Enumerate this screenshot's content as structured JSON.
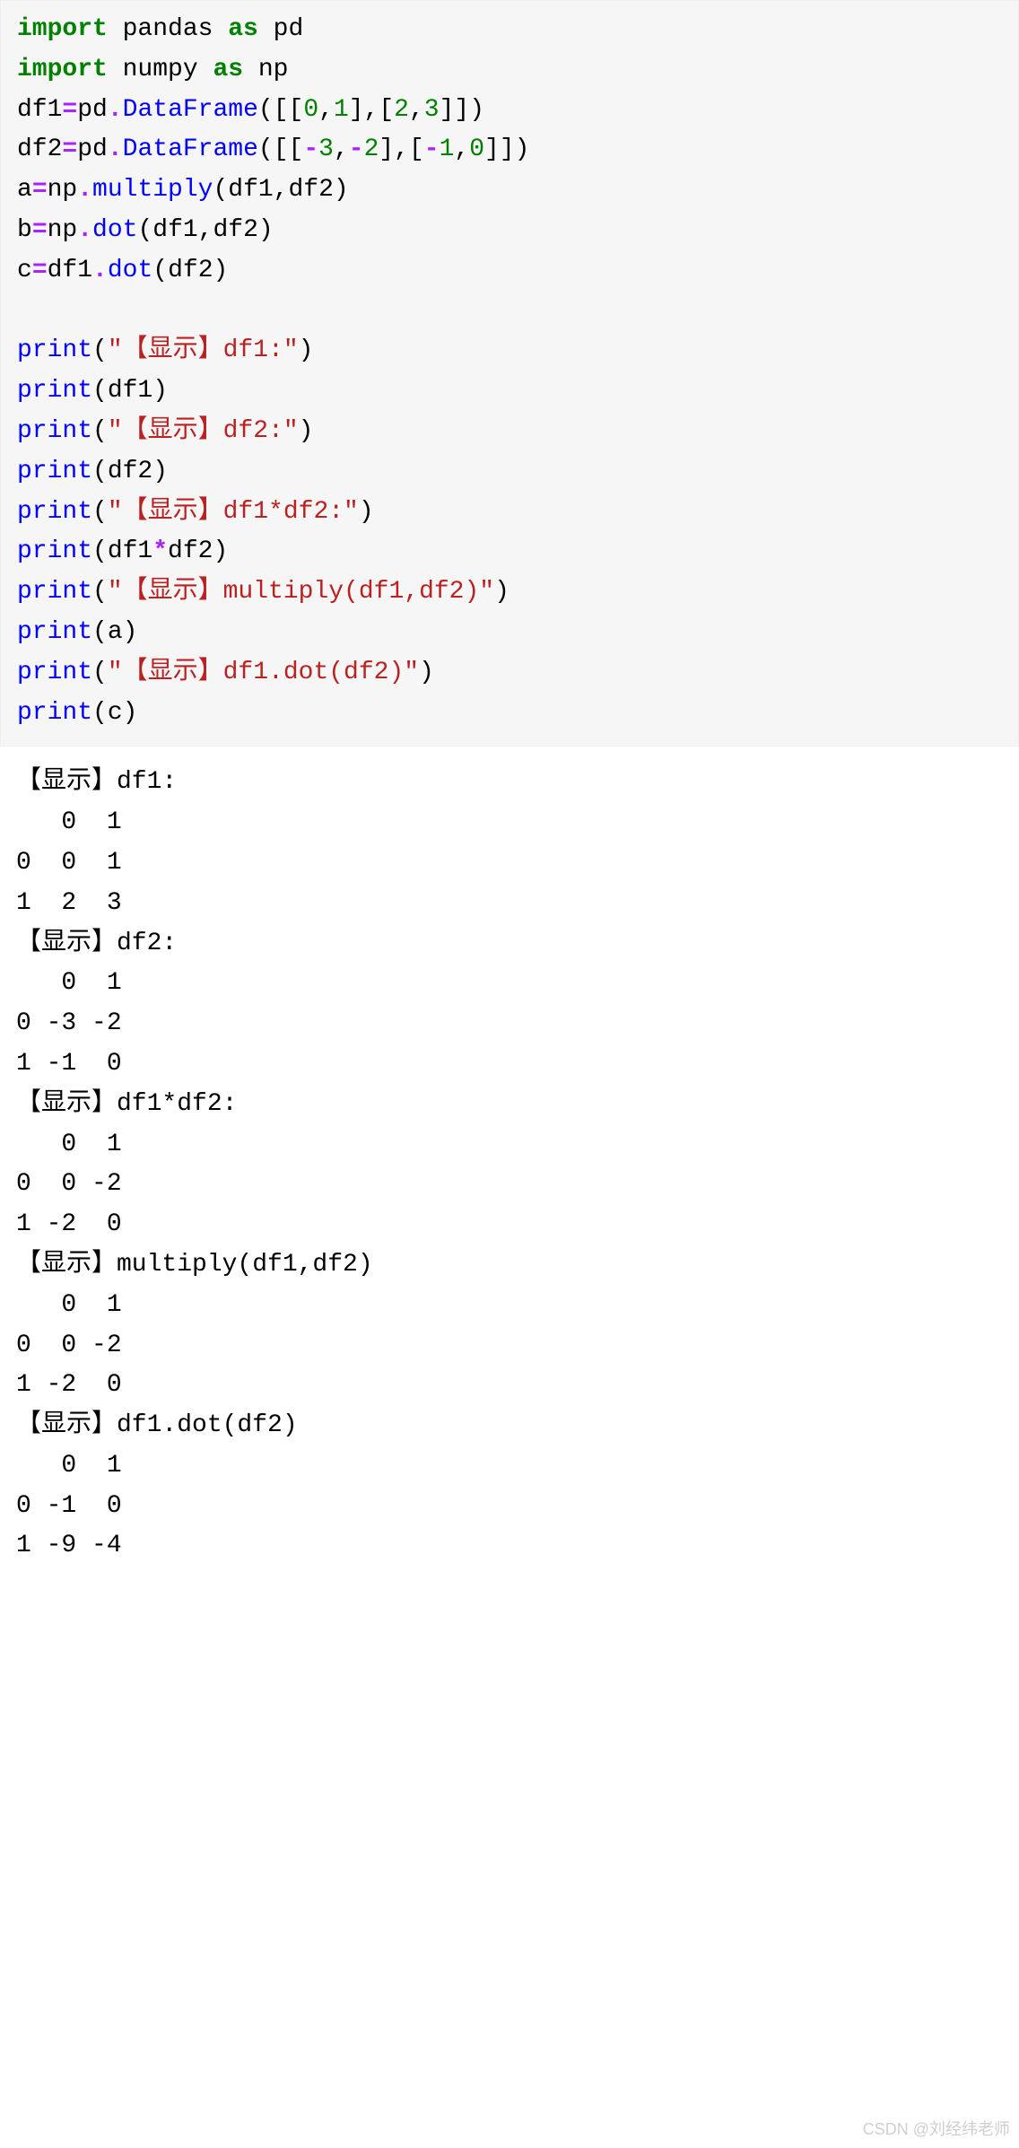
{
  "code": {
    "l1_kw1": "import",
    "l1_mod": " pandas ",
    "l1_kw2": "as",
    "l1_alias": " pd",
    "l2_kw1": "import",
    "l2_mod": " numpy ",
    "l2_kw2": "as",
    "l2_alias": " np",
    "l3_a": "df1",
    "l3_eq": "=",
    "l3_b": "pd",
    "l3_dot1": ".",
    "l3_fn": "DataFrame",
    "l3_p1": "([[",
    "l3_n1": "0",
    "l3_c1": ",",
    "l3_n2": "1",
    "l3_c2": "],[",
    "l3_n3": "2",
    "l3_c3": ",",
    "l3_n4": "3",
    "l3_p2": "]])",
    "l4_a": "df2",
    "l4_eq": "=",
    "l4_b": "pd",
    "l4_dot1": ".",
    "l4_fn": "DataFrame",
    "l4_p1": "([[",
    "l4_m1": "-",
    "l4_n1": "3",
    "l4_c1": ",",
    "l4_m2": "-",
    "l4_n2": "2",
    "l4_c2": "],[",
    "l4_m3": "-",
    "l4_n3": "1",
    "l4_c3": ",",
    "l4_n4": "0",
    "l4_p2": "]])",
    "l5_a": "a",
    "l5_eq": "=",
    "l5_b": "np",
    "l5_dot": ".",
    "l5_fn": "multiply",
    "l5_args": "(df1,df2)",
    "l6_a": "b",
    "l6_eq": "=",
    "l6_b": "np",
    "l6_dot": ".",
    "l6_fn": "dot",
    "l6_args": "(df1,df2)",
    "l7_a": "c",
    "l7_eq": "=",
    "l7_b": "df1",
    "l7_dot": ".",
    "l7_fn": "dot",
    "l7_args": "(df2)",
    "blank": " ",
    "p1_fn": "print",
    "p1_p1": "(",
    "p1_s": "\"【显示】df1:\"",
    "p1_p2": ")",
    "p2_fn": "print",
    "p2_args": "(df1)",
    "p3_fn": "print",
    "p3_p1": "(",
    "p3_s": "\"【显示】df2:\"",
    "p3_p2": ")",
    "p4_fn": "print",
    "p4_args": "(df2)",
    "p5_fn": "print",
    "p5_p1": "(",
    "p5_s": "\"【显示】df1*df2:\"",
    "p5_p2": ")",
    "p6_fn": "print",
    "p6_a": "(df1",
    "p6_op": "*",
    "p6_b": "df2)",
    "p7_fn": "print",
    "p7_p1": "(",
    "p7_s": "\"【显示】multiply(df1,df2)\"",
    "p7_p2": ")",
    "p8_fn": "print",
    "p8_args": "(a)",
    "p9_fn": "print",
    "p9_p1": "(",
    "p9_s": "\"【显示】df1.dot(df2)\"",
    "p9_p2": ")",
    "p10_fn": "print",
    "p10_args": "(c)"
  },
  "output": "【显示】df1:\n   0  1\n0  0  1\n1  2  3\n【显示】df2:\n   0  1\n0 -3 -2\n1 -1  0\n【显示】df1*df2:\n   0  1\n0  0 -2\n1 -2  0\n【显示】multiply(df1,df2)\n   0  1\n0  0 -2\n1 -2  0\n【显示】df1.dot(df2)\n   0  1\n0 -1  0\n1 -9 -4",
  "watermark": "CSDN @刘经纬老师"
}
